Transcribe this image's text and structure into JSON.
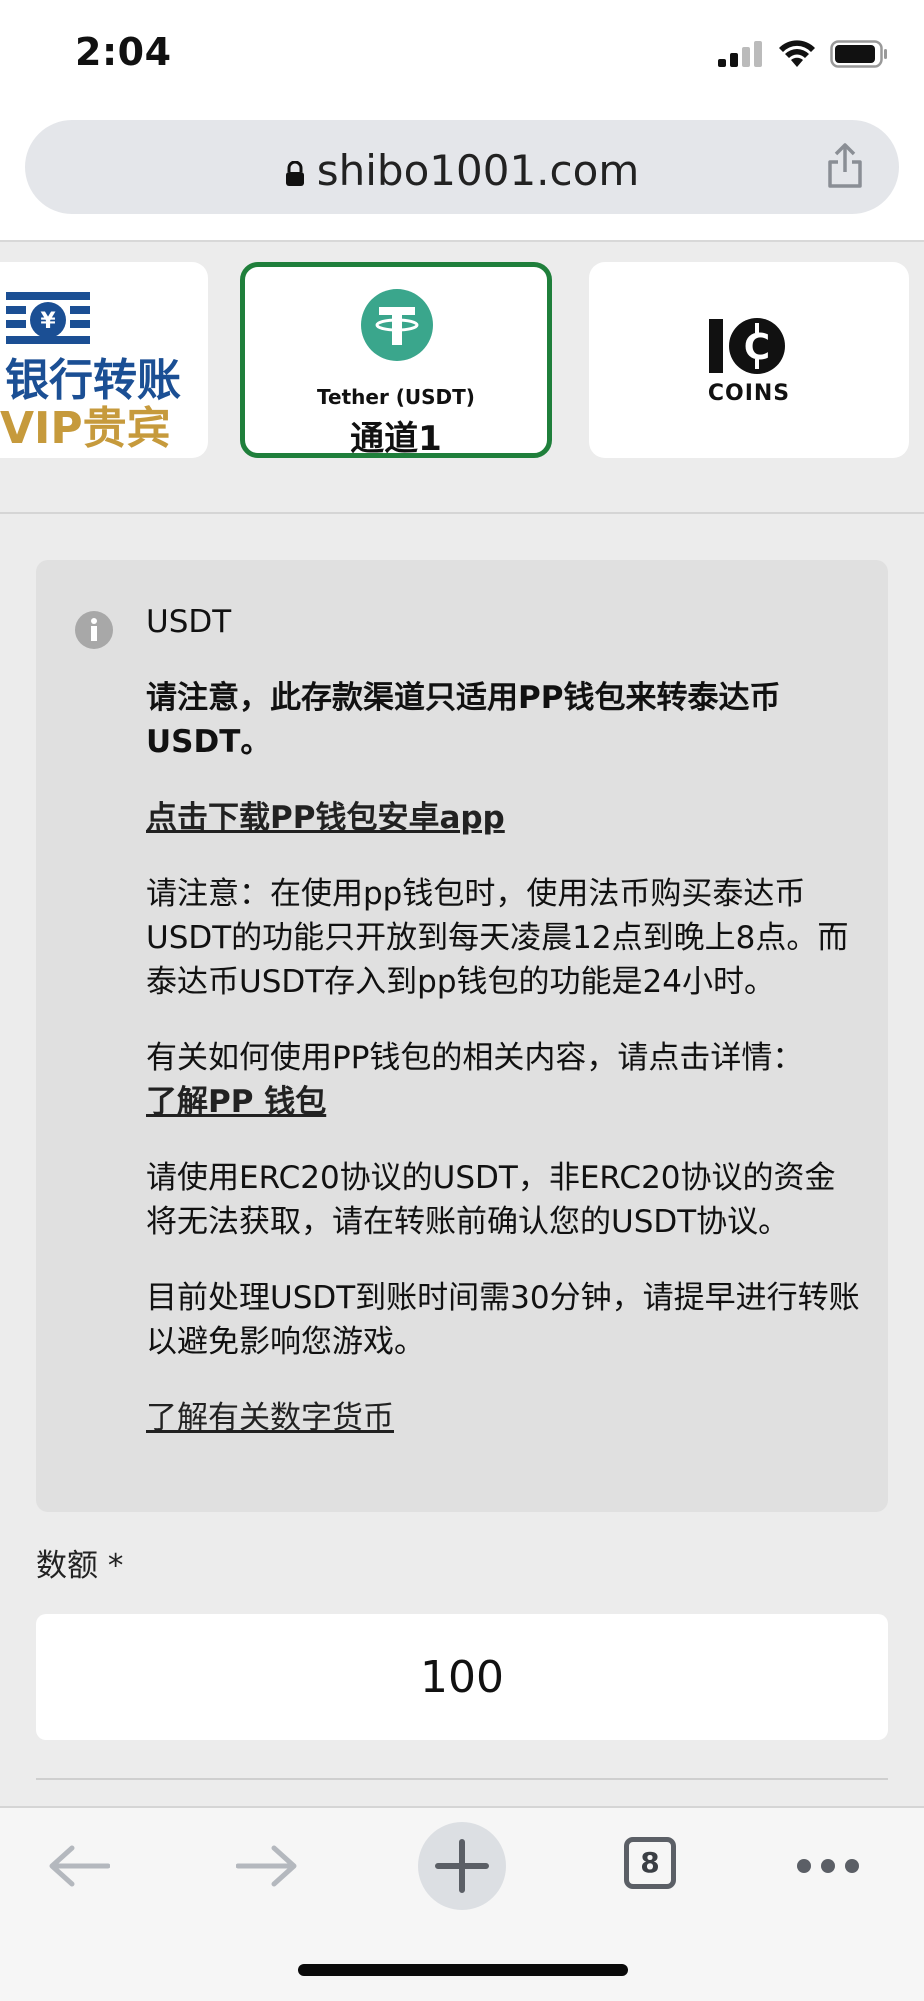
{
  "status_bar": {
    "time": "2:04"
  },
  "browser": {
    "url": "shibo1001.com",
    "tab_count": "8"
  },
  "channels": [
    {
      "line1": "银行转账",
      "line2": "VIP贵宾",
      "selected": false
    },
    {
      "name": "Tether (USDT)",
      "channel": "通道1",
      "selected": true
    },
    {
      "label": "COINS",
      "selected": false
    }
  ],
  "info": {
    "title": "USDT",
    "notice_bold": "请注意，此存款渠道只适用PP钱包来转泰达币USDT。",
    "download_link": "点击下载PP钱包安卓app",
    "para_hours": "请注意：在使用pp钱包时，使用法币购买泰达币USDT的功能只开放到每天凌晨12点到晚上8点。而泰达币USDT存入到pp钱包的功能是24小时。",
    "para_howto": "有关如何使用PP钱包的相关内容，请点击详情：",
    "howto_link": "了解PP 钱包",
    "para_erc20": "请使用ERC20协议的USDT，非ERC20协议的资金将无法获取，请在转账前确认您的USDT协议。",
    "para_time": "目前处理USDT到账时间需30分钟，请提早进行转账以避免影响您游戏。",
    "crypto_link": "了解有关数字货币"
  },
  "amount": {
    "label": "数额 *",
    "value": "100"
  },
  "colors": {
    "selected_border": "#1f7f3b",
    "tether_green": "#3aa68c",
    "bank_blue": "#1b4f94",
    "bank_gold": "#c69a3c"
  },
  "icons": [
    "signal-icon",
    "wifi-icon",
    "battery-icon",
    "lock-icon",
    "share-icon",
    "info-icon",
    "back-arrow-icon",
    "forward-arrow-icon",
    "plus-icon",
    "more-icon"
  ]
}
